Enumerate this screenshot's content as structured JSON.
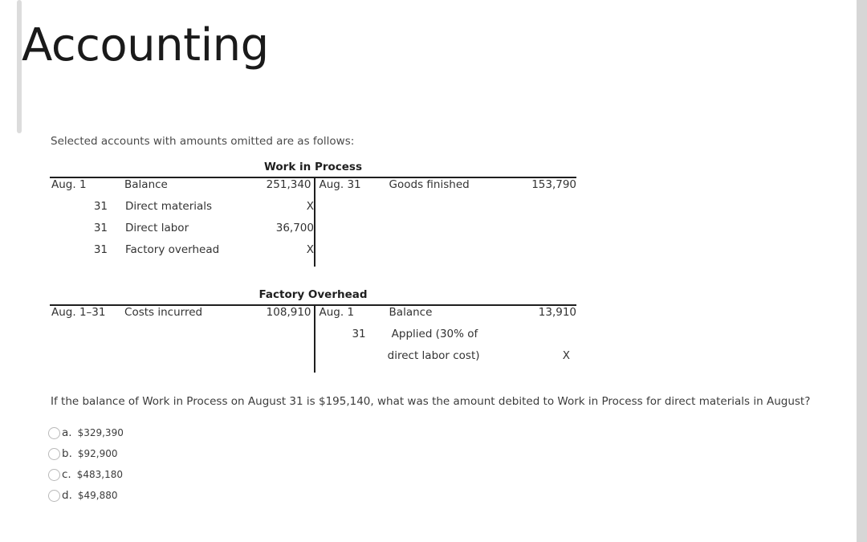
{
  "title": "Accounting",
  "intro": "Selected accounts with amounts omitted are as follows:",
  "accounts": [
    {
      "heading": "Work in Process",
      "debits": [
        {
          "date": "Aug. 1",
          "desc": "Balance",
          "amount": "251,340"
        },
        {
          "date": "31",
          "desc": "Direct materials",
          "amount": "X"
        },
        {
          "date": "31",
          "desc": "Direct labor",
          "amount": "36,700"
        },
        {
          "date": "31",
          "desc": "Factory overhead",
          "amount": "X"
        }
      ],
      "credits": [
        {
          "date": "Aug. 31",
          "desc": "Goods finished",
          "amount": "153,790"
        }
      ]
    },
    {
      "heading": "Factory Overhead",
      "debits": [
        {
          "date": "Aug. 1–31",
          "desc": "Costs incurred",
          "amount": "108,910"
        }
      ],
      "credits": [
        {
          "date": "Aug. 1",
          "desc": "Balance",
          "amount": "13,910"
        },
        {
          "date": "31",
          "desc": "Applied (30% of",
          "amount": ""
        },
        {
          "date": "",
          "desc": "direct labor cost)",
          "amount": "X"
        }
      ]
    }
  ],
  "question": "If the balance of Work in Process on August 31 is $195,140, what was the amount debited to Work in Process for direct materials in August?",
  "options": [
    {
      "letter": "a.",
      "value": "$329,390"
    },
    {
      "letter": "b.",
      "value": "$92,900"
    },
    {
      "letter": "c.",
      "value": "$483,180"
    },
    {
      "letter": "d.",
      "value": "$49,880"
    }
  ]
}
